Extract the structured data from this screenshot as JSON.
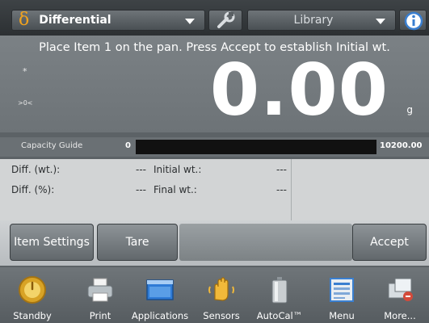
{
  "topbar": {
    "app_icon": "delta-icon",
    "app_glyph": "δ",
    "app_name": "Differential",
    "library_label": "Library"
  },
  "display": {
    "instruction": "Place Item 1 on the pan.  Press Accept to establish Initial wt.",
    "stable_indicator": "*",
    "zero_indicator": ">0<",
    "weight": "0.00",
    "unit": "g"
  },
  "capacity": {
    "label": "Capacity Guide",
    "min": "0",
    "max": "10200.00"
  },
  "data": {
    "diff_wt_label": "Diff. (wt.):",
    "diff_wt_value": "---",
    "initial_wt_label": "Initial wt.:",
    "initial_wt_value": "---",
    "diff_pct_label": "Diff. (%):",
    "diff_pct_value": "---",
    "final_wt_label": "Final wt.:",
    "final_wt_value": "---"
  },
  "actions": {
    "item_settings": "Item Settings",
    "tare": "Tare",
    "accept": "Accept"
  },
  "nav": [
    {
      "label": "Standby",
      "icon": "standby-icon"
    },
    {
      "label": "Print",
      "icon": "printer-icon"
    },
    {
      "label": "Applications",
      "icon": "applications-icon"
    },
    {
      "label": "Sensors",
      "icon": "sensors-hand-icon"
    },
    {
      "label": "AutoCal™",
      "icon": "autocal-weight-icon"
    },
    {
      "label": "Menu",
      "icon": "menu-icon"
    },
    {
      "label": "More...",
      "icon": "more-icon"
    }
  ],
  "colors": {
    "accent_orange": "#f0a21e",
    "display_bg": "#737a7e",
    "data_bg": "#d2d4d5",
    "info_blue": "#3a7fd0"
  }
}
